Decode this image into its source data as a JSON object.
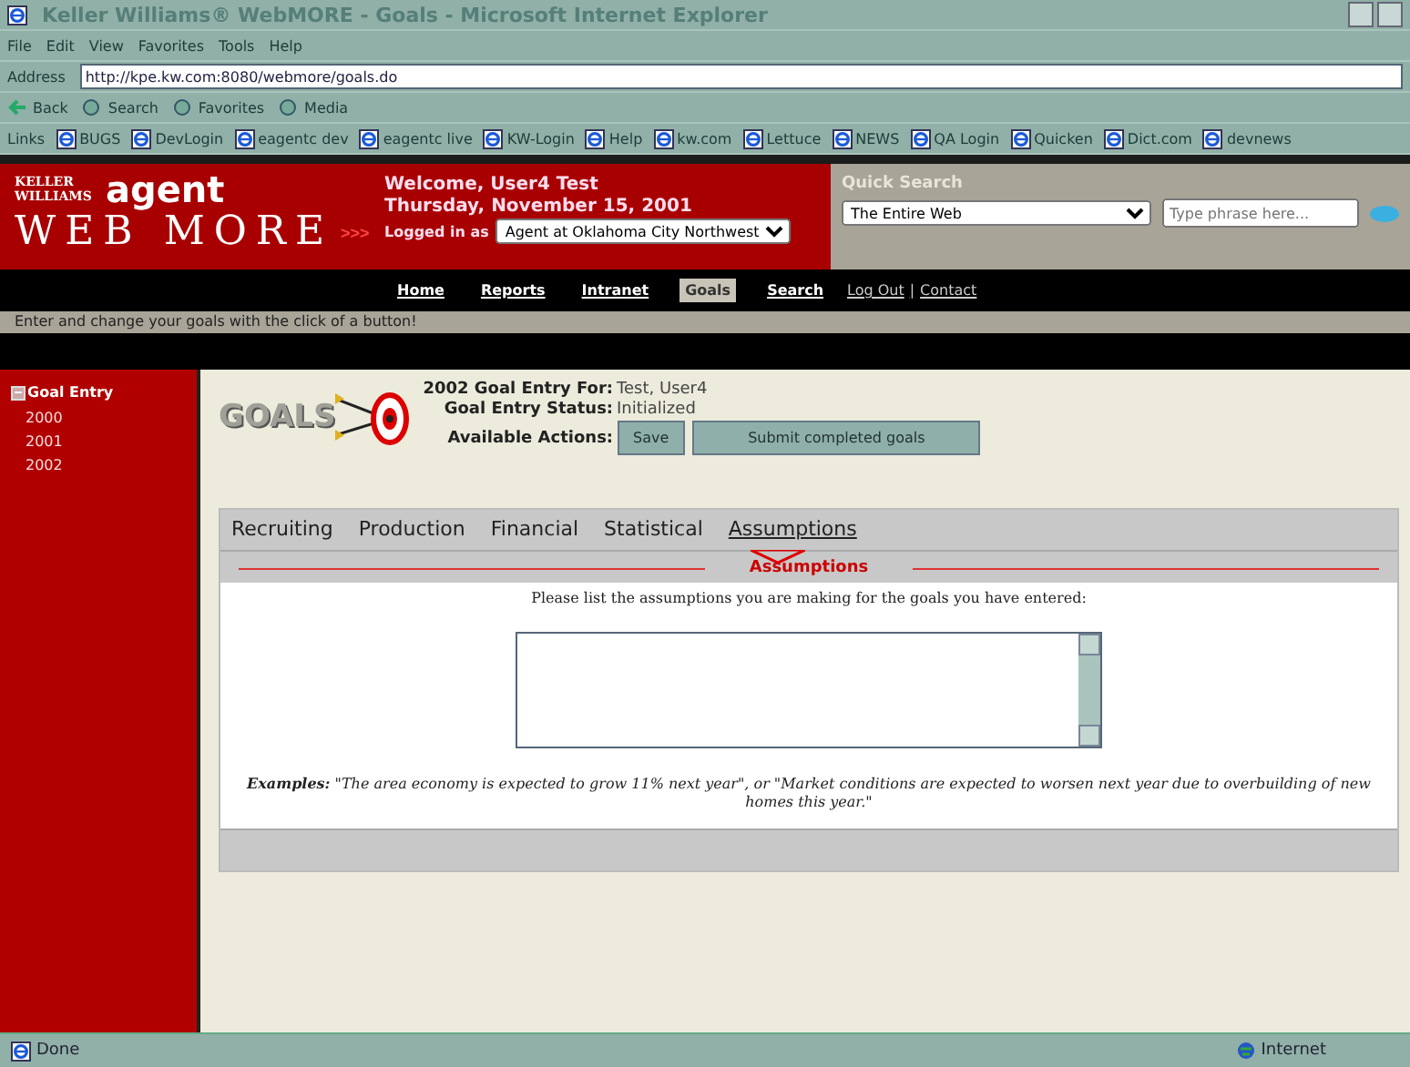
{
  "window": {
    "title": "Keller Williams® WebMORE - Goals - Microsoft Internet Explorer"
  },
  "menu": [
    "File",
    "Edit",
    "View",
    "Favorites",
    "Tools",
    "Help"
  ],
  "address": {
    "label": "Address",
    "url": "http://kpe.kw.com:8080/webmore/goals.do"
  },
  "toolbar": [
    "Back",
    "Search",
    "Favorites",
    "Media"
  ],
  "links": {
    "label": "Links",
    "items": [
      "BUGS",
      "DevLogin",
      "eagentc dev",
      "eagentc live",
      "KW-Login",
      "Help",
      "kw.com",
      "Lettuce",
      "NEWS",
      "QA Login",
      "Quicken",
      "Dict.com",
      "devnews"
    ]
  },
  "header": {
    "brand": "KELLER WILLIAMS",
    "agent": "agent",
    "webmore": "WEB MORE",
    "arrows": ">>>",
    "welcome": "Welcome, User4 Test",
    "date": "Thursday, November 15, 2001",
    "logged_in_label": "Logged in as",
    "office": "Agent at Oklahoma City Northwest",
    "quick_search": {
      "title": "Quick Search",
      "scope": "The Entire Web",
      "placeholder": "Type phrase here..."
    }
  },
  "nav": [
    {
      "label": "Home",
      "selected": false
    },
    {
      "label": "Reports",
      "selected": false
    },
    {
      "label": "Intranet",
      "selected": false
    },
    {
      "label": "Goals",
      "selected": true
    },
    {
      "label": "Search",
      "selected": false
    }
  ],
  "util_links": {
    "separator": "|",
    "items": [
      "Log Out",
      "Contact"
    ]
  },
  "tagline": "Enter and change your goals with the click of a button!",
  "sidebar": {
    "items": [
      {
        "label": "Goal Entry",
        "expanded": true,
        "children": [
          {
            "label": "2000"
          },
          {
            "label": "2001"
          },
          {
            "label": "2002"
          }
        ]
      }
    ]
  },
  "goals": {
    "logo": "GOALS",
    "rows": [
      {
        "label": "2002 Goal Entry For:",
        "value": "Test, User4"
      },
      {
        "label": "Goal Entry Status:",
        "value": "Initialized"
      }
    ],
    "actions_label": "Available Actions:",
    "actions": [
      "Save",
      "Submit completed goals"
    ]
  },
  "tabs": [
    {
      "label": "Recruiting",
      "selected": false
    },
    {
      "label": "Production",
      "selected": false
    },
    {
      "label": "Financial",
      "selected": false
    },
    {
      "label": "Statistical",
      "selected": false
    },
    {
      "label": "Assumptions",
      "selected": true
    }
  ],
  "section_title": "Assumptions",
  "prompt": "Please list the assumptions you are making for the goals you have entered:",
  "examples": "**Examples:** \"The area economy is expected to grow 11% next year\", or \"Market conditions are expected to worsen next year due to overbuilding of new homes this year.\"",
  "status_bar": {
    "text": "Done",
    "zone": "Internet"
  }
}
